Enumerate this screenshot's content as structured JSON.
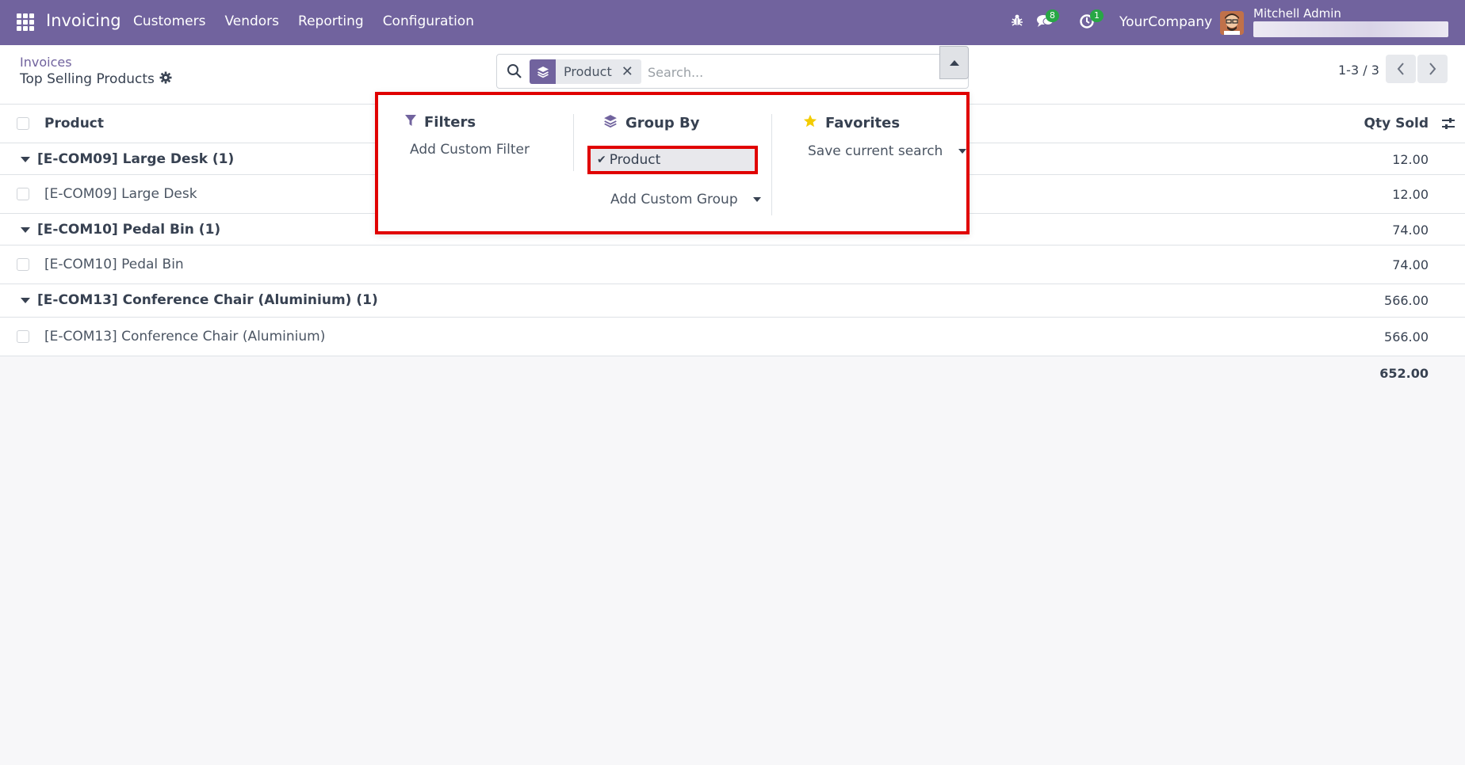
{
  "navbar": {
    "app_title": "Invoicing",
    "menu": [
      "Customers",
      "Vendors",
      "Reporting",
      "Configuration"
    ],
    "messages_badge": "8",
    "activities_badge": "1",
    "company": "YourCompany",
    "user_name": "Mitchell Admin"
  },
  "control": {
    "breadcrumb": "Invoices",
    "title": "Top Selling Products",
    "search": {
      "facet_label": "Product",
      "placeholder": "Search..."
    },
    "pager": "1-3 / 3"
  },
  "list": {
    "columns": {
      "product": "Product",
      "qty": "Qty Sold"
    },
    "groups": [
      {
        "label": "[E-COM09] Large Desk (1)",
        "total": "12.00",
        "rows": [
          {
            "product": "[E-COM09] Large Desk",
            "qty": "12.00"
          }
        ]
      },
      {
        "label": "[E-COM10] Pedal Bin (1)",
        "total": "74.00",
        "rows": [
          {
            "product": "[E-COM10] Pedal Bin",
            "qty": "74.00"
          }
        ]
      },
      {
        "label": "[E-COM13] Conference Chair (Aluminium) (1)",
        "total": "566.00",
        "rows": [
          {
            "product": "[E-COM13] Conference Chair (Aluminium)",
            "qty": "566.00"
          }
        ]
      }
    ],
    "grand_total": "652.00"
  },
  "dropdown": {
    "filters": {
      "title": "Filters",
      "add_custom": "Add Custom Filter"
    },
    "group_by": {
      "title": "Group By",
      "selected": "Product",
      "add_custom": "Add Custom Group"
    },
    "favorites": {
      "title": "Favorites",
      "save": "Save current search"
    }
  },
  "colors": {
    "brand": "#71639e",
    "highlight": "#e00000",
    "badge": "#28a745",
    "star": "#f3cc00"
  }
}
